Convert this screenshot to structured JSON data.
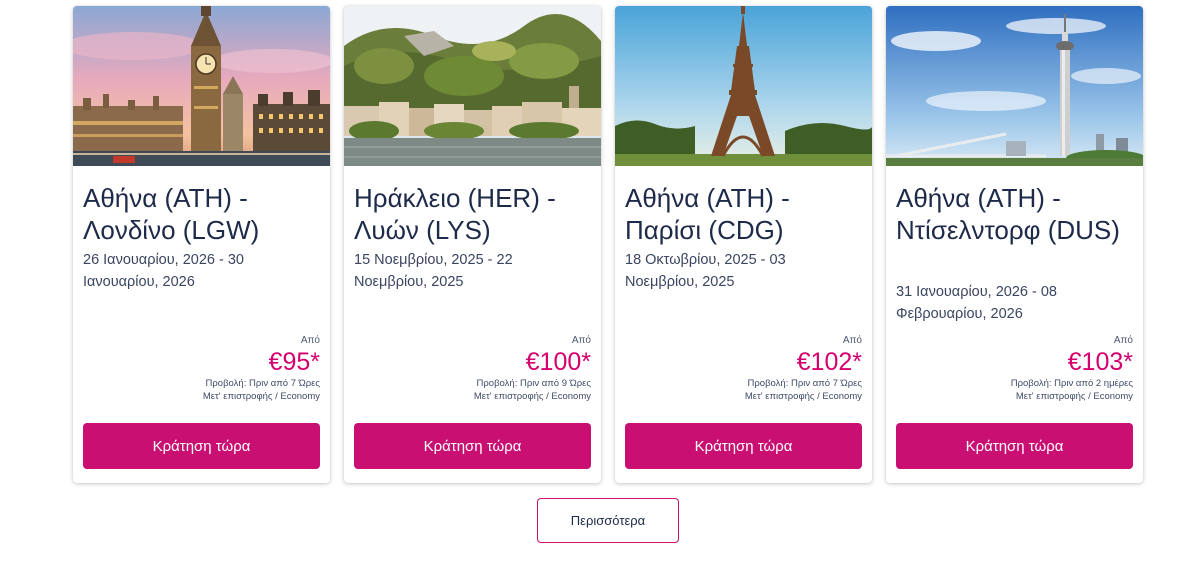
{
  "cards": [
    {
      "image": "london-big-ben-photo",
      "route": "Αθήνα (ATH) - Λονδίνο (LGW)",
      "dates": "26 Ιανουαρίου, 2026 - 30 Ιανουαρίου, 2026",
      "from_label": "Από",
      "price": "€95*",
      "seen": "Προβολή: Πριν από 7 Ώρες",
      "trip": "Μετ' επιστροφής / Economy",
      "button": "Κράτηση τώρα"
    },
    {
      "image": "lyon-riverside-photo",
      "route": "Ηράκλειο (HER) - Λυών (LYS)",
      "dates": "15 Νοεμβρίου, 2025 - 22 Νοεμβρίου, 2025",
      "from_label": "Από",
      "price": "€100*",
      "seen": "Προβολή: Πριν από 9 Ώρες",
      "trip": "Μετ' επιστροφής / Economy",
      "button": "Κράτηση τώρα"
    },
    {
      "image": "paris-eiffel-tower-photo",
      "route": "Αθήνα (ATH) - Παρίσι (CDG)",
      "dates": "18 Οκτωβρίου, 2025 - 03 Νοεμβρίου, 2025",
      "from_label": "Από",
      "price": "€102*",
      "seen": "Προβολή: Πριν από 7 Ώρες",
      "trip": "Μετ' επιστροφής / Economy",
      "button": "Κράτηση τώρα"
    },
    {
      "image": "dusseldorf-rhine-tower-photo",
      "route": "Αθήνα (ATH) - Ντίσελντορφ (DUS)",
      "dates": "31 Ιανουαρίου, 2026 - 08 Φεβρουαρίου, 2026",
      "from_label": "Από",
      "price": "€103*",
      "seen": "Προβολή: Πριν από 2 ημέρες",
      "trip": "Μετ' επιστροφής / Economy",
      "button": "Κράτηση τώρα"
    }
  ],
  "more_button": "Περισσότερα",
  "colors": {
    "accent": "#c90f72",
    "price": "#d5006d",
    "text": "#1e2a4a"
  }
}
